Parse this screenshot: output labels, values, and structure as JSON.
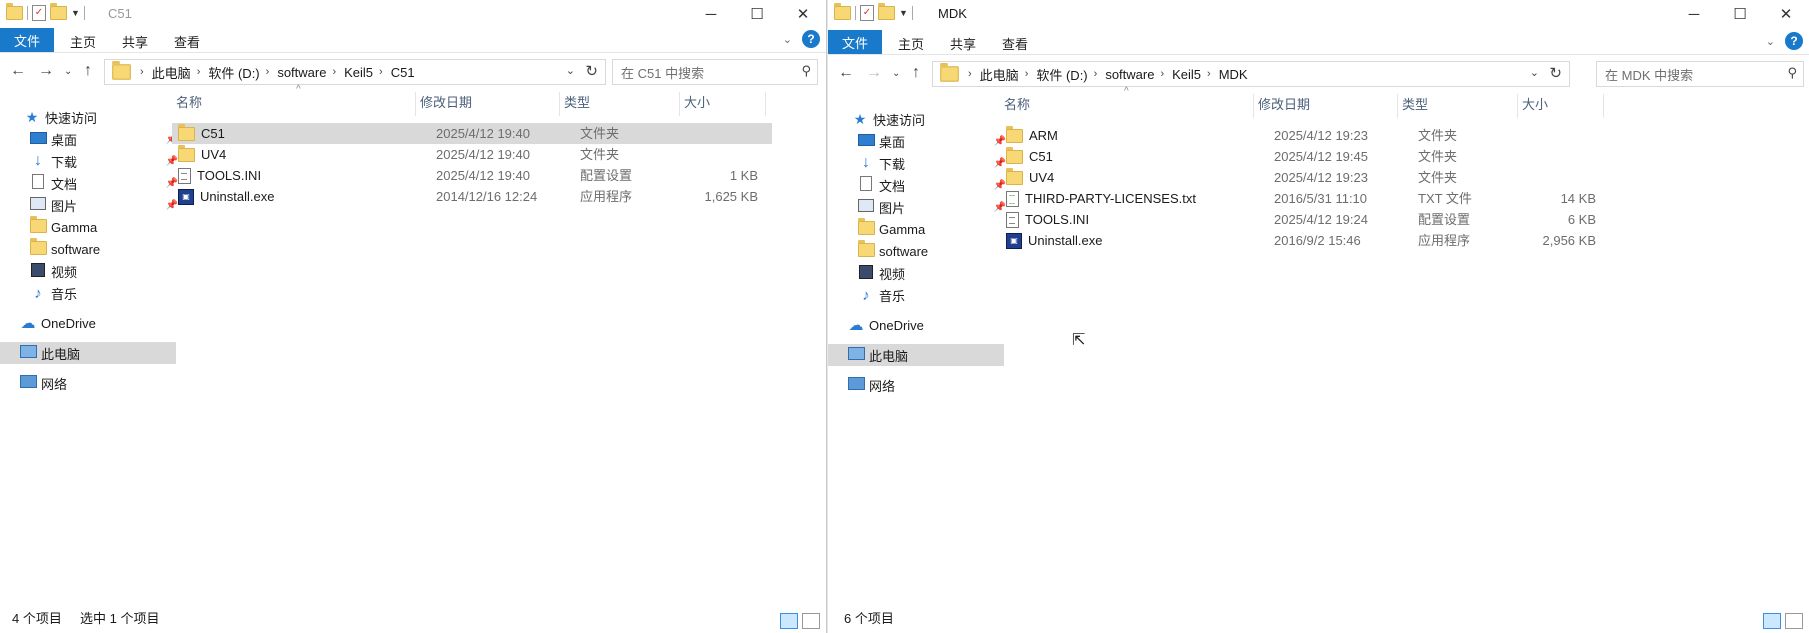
{
  "left": {
    "title": "C51",
    "ribbon": {
      "file": "文件",
      "home": "主页",
      "share": "共享",
      "view": "查看"
    },
    "breadcrumb": [
      "此电脑",
      "软件 (D:)",
      "software",
      "Keil5",
      "C51"
    ],
    "search_placeholder": "在 C51 中搜索",
    "columns": {
      "name": "名称",
      "date": "修改日期",
      "type": "类型",
      "size": "大小"
    },
    "files": [
      {
        "name": "C51",
        "date": "2025/4/12 19:40",
        "type": "文件夹",
        "size": "",
        "icon": "folder-icon"
      },
      {
        "name": "UV4",
        "date": "2025/4/12 19:40",
        "type": "文件夹",
        "size": "",
        "icon": "folder-icon"
      },
      {
        "name": "TOOLS.INI",
        "date": "2025/4/12 19:40",
        "type": "配置设置",
        "size": "1 KB",
        "icon": "ini-file-icon"
      },
      {
        "name": "Uninstall.exe",
        "date": "2014/12/16 12:24",
        "type": "应用程序",
        "size": "1,625 KB",
        "icon": "exe-icon"
      }
    ],
    "status_count": "4 个项目",
    "status_selected": "选中 1 个项目"
  },
  "right": {
    "title": "MDK",
    "ribbon": {
      "file": "文件",
      "home": "主页",
      "share": "共享",
      "view": "查看"
    },
    "breadcrumb": [
      "此电脑",
      "软件 (D:)",
      "software",
      "Keil5",
      "MDK"
    ],
    "search_placeholder": "在 MDK 中搜索",
    "columns": {
      "name": "名称",
      "date": "修改日期",
      "type": "类型",
      "size": "大小"
    },
    "files": [
      {
        "name": "ARM",
        "date": "2025/4/12 19:23",
        "type": "文件夹",
        "size": "",
        "icon": "folder-icon"
      },
      {
        "name": "C51",
        "date": "2025/4/12 19:45",
        "type": "文件夹",
        "size": "",
        "icon": "folder-icon"
      },
      {
        "name": "UV4",
        "date": "2025/4/12 19:23",
        "type": "文件夹",
        "size": "",
        "icon": "folder-icon"
      },
      {
        "name": "THIRD-PARTY-LICENSES.txt",
        "date": "2016/5/31 11:10",
        "type": "TXT 文件",
        "size": "14 KB",
        "icon": "txt-file-icon"
      },
      {
        "name": "TOOLS.INI",
        "date": "2025/4/12 19:24",
        "type": "配置设置",
        "size": "6 KB",
        "icon": "ini-file-icon"
      },
      {
        "name": "Uninstall.exe",
        "date": "2016/9/2 15:46",
        "type": "应用程序",
        "size": "2,956 KB",
        "icon": "exe-icon"
      }
    ],
    "status_count": "6 个项目"
  },
  "sidebar": {
    "quick_access": "快速访问",
    "desktop": "桌面",
    "downloads": "下载",
    "documents": "文档",
    "pictures": "图片",
    "gamma": "Gamma",
    "software": "software",
    "videos": "视频",
    "music": "音乐",
    "onedrive": "OneDrive",
    "this_pc": "此电脑",
    "network": "网络"
  },
  "colors": {
    "accent": "#1979ca",
    "selection": "#d9d9d9",
    "folder": "#f8d775"
  }
}
